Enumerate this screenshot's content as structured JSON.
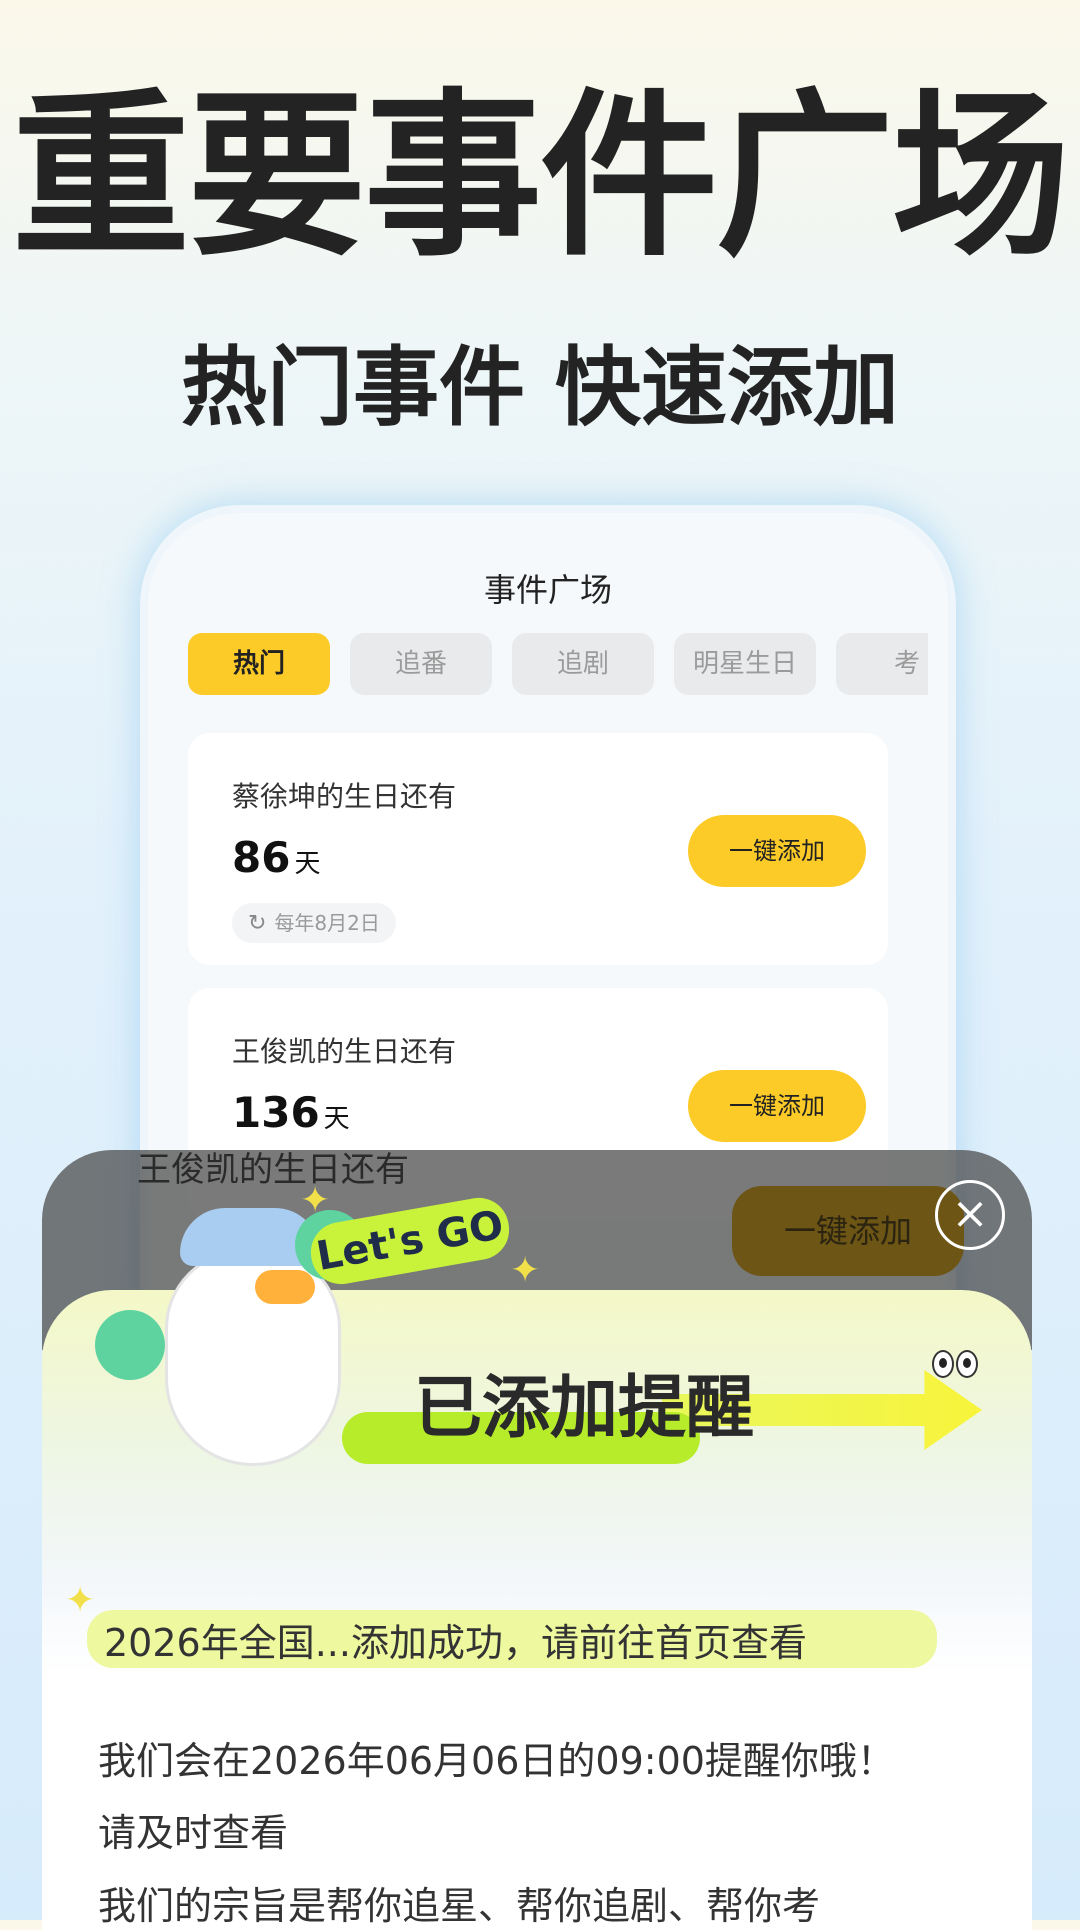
{
  "hero": {
    "title": "重要事件广场",
    "subtitle": "热门事件 快速添加"
  },
  "phone": {
    "screen_title": "事件广场",
    "tabs": [
      {
        "label": "热门",
        "active": true
      },
      {
        "label": "追番",
        "active": false
      },
      {
        "label": "追剧",
        "active": false
      },
      {
        "label": "明星生日",
        "active": false
      },
      {
        "label": "考",
        "active": false
      }
    ],
    "cards": [
      {
        "title": "蔡徐坤的生日还有",
        "days": "86",
        "unit": "天",
        "repeat": "每年8月2日",
        "button": "一键添加"
      },
      {
        "title": "王俊凯的生日还有",
        "days": "136",
        "unit": "天",
        "button": "一键添加"
      }
    ]
  },
  "overlay": {
    "dim_text": "王俊凯的生日还有",
    "dim_button": "一键添加"
  },
  "modal": {
    "badge": "Let's GO",
    "heading": "已添加提醒",
    "success": "2026年全国...添加成功，请前往首页查看",
    "message_line1": "我们会在2026年06月06日的09:00提醒你哦！",
    "message_line2": "请及时查看",
    "message_line3": "我们的宗旨是帮你追星、帮你追剧、帮你考"
  },
  "colors": {
    "accent": "#fccb28",
    "highlight": "#b7ec2a",
    "tab_inactive": "#e9eaec"
  }
}
